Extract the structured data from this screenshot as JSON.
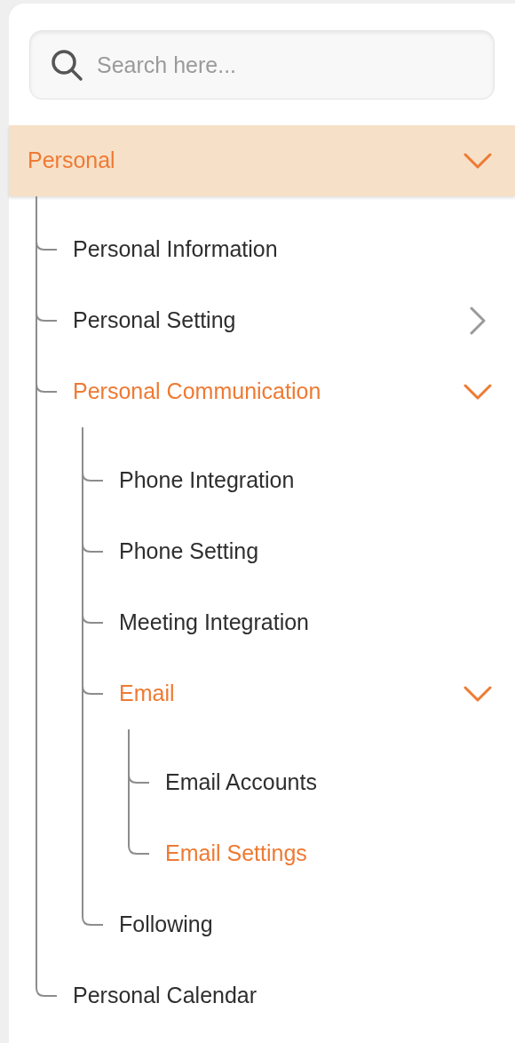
{
  "search": {
    "placeholder": "Search here..."
  },
  "section": {
    "label": "Personal",
    "expanded": true,
    "selected": true,
    "children": [
      {
        "label": "Personal Information",
        "selected": false
      },
      {
        "label": "Personal Setting",
        "selected": false,
        "expanded": false
      },
      {
        "label": "Personal Communication",
        "selected": true,
        "expanded": true,
        "children": [
          {
            "label": "Phone Integration",
            "selected": false
          },
          {
            "label": "Phone Setting",
            "selected": false
          },
          {
            "label": "Meeting Integration",
            "selected": false
          },
          {
            "label": "Email",
            "selected": true,
            "expanded": true,
            "children": [
              {
                "label": "Email Accounts",
                "selected": false
              },
              {
                "label": "Email Settings",
                "selected": true
              }
            ]
          },
          {
            "label": "Following",
            "selected": false
          }
        ]
      },
      {
        "label": "Personal Calendar",
        "selected": false
      }
    ]
  }
}
